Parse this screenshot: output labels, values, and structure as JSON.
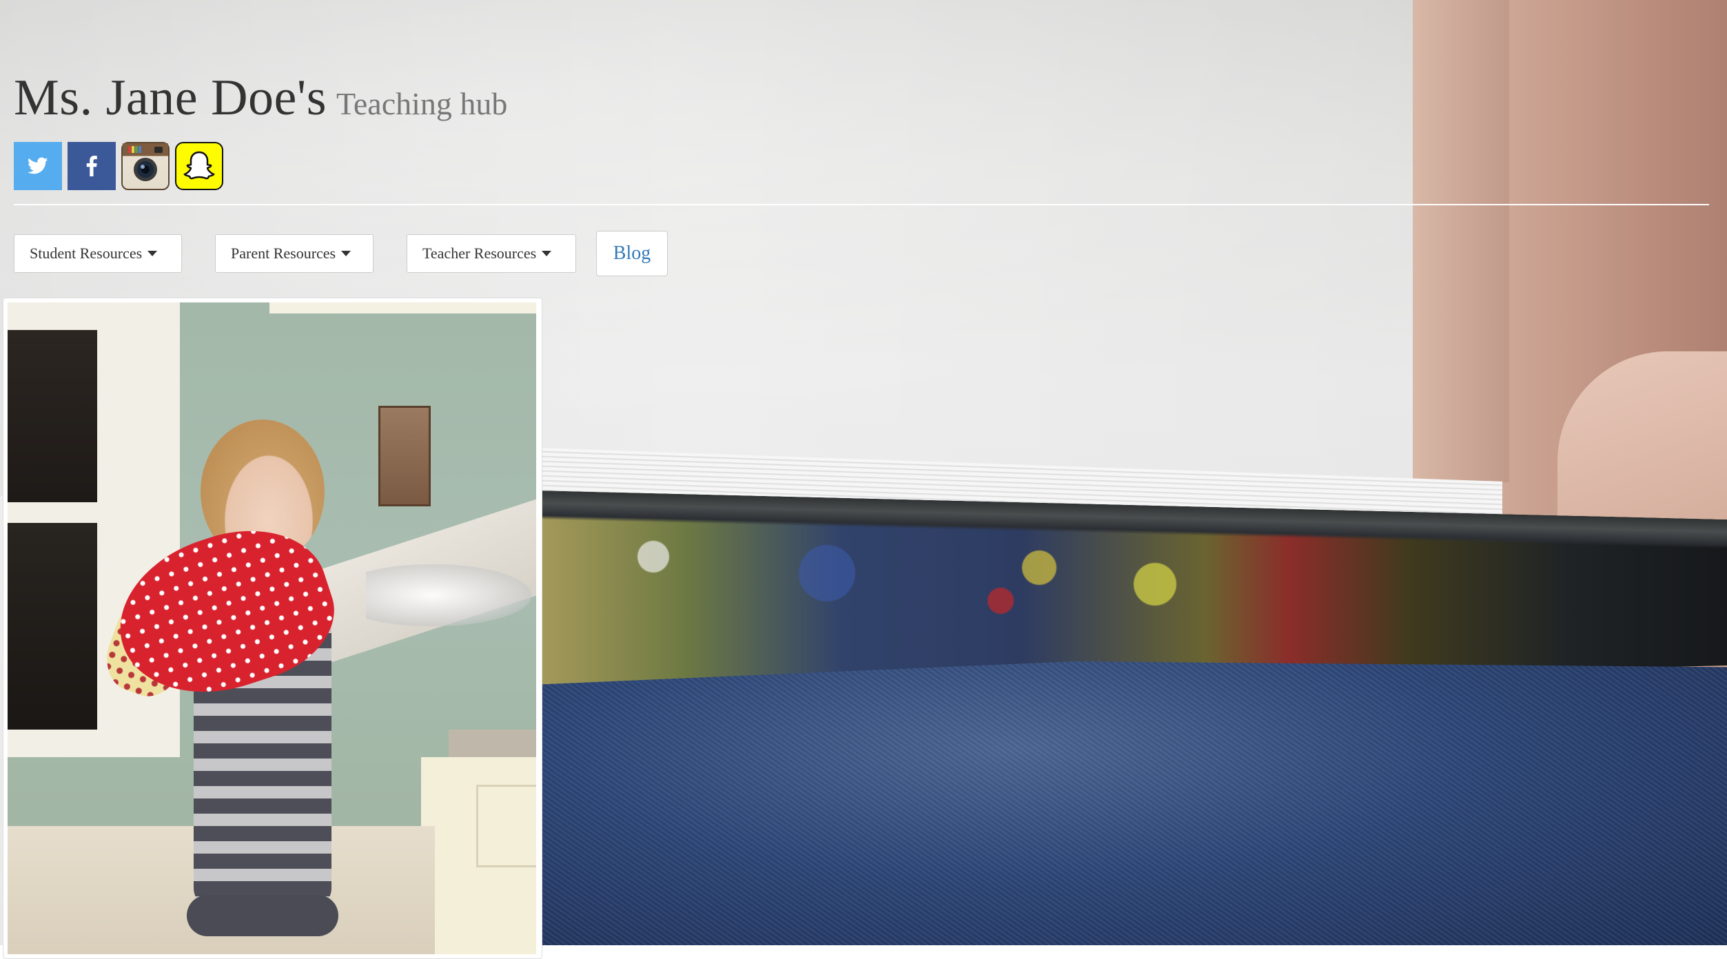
{
  "header": {
    "name": "Ms. Jane Doe's",
    "tagline": "Teaching hub"
  },
  "social": [
    {
      "id": "twitter",
      "icon": "twitter-icon",
      "glyph": "🐦",
      "color": "#55acee"
    },
    {
      "id": "facebook",
      "icon": "facebook-icon",
      "glyph": "f",
      "color": "#3b5998"
    },
    {
      "id": "instagram",
      "icon": "instagram-icon",
      "glyph": "◉",
      "color": "#8a6a4a"
    },
    {
      "id": "snapchat",
      "icon": "snapchat-icon",
      "glyph": "👻",
      "color": "#fffc00"
    }
  ],
  "nav": {
    "student": "Student Resources",
    "parent": "Parent Resources",
    "teacher": "Teacher Resources",
    "blog": "Blog"
  },
  "colors": {
    "link": "#337ab7",
    "title": "#333333",
    "tagline": "#777777"
  }
}
